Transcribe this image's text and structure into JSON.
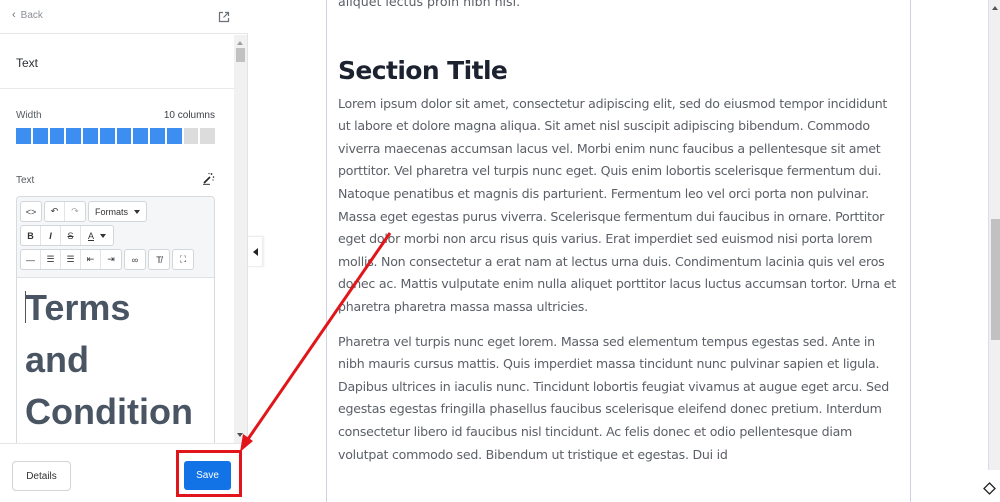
{
  "panel": {
    "back_label": "Back",
    "section_title": "Text",
    "width_label": "Width",
    "width_value": "10 columns",
    "columns_total": 12,
    "columns_selected": 10,
    "text_label": "Text",
    "toolbar": {
      "formats_label": "Formats",
      "buttons_row1": [
        "source-code",
        "undo",
        "redo"
      ],
      "buttons_row2": [
        "bold",
        "italic",
        "strikethrough",
        "text-color"
      ],
      "buttons_row3": [
        "horizontal-rule",
        "bullet-list",
        "numbered-list",
        "outdent",
        "indent",
        "link",
        "clear-formatting",
        "fullscreen"
      ],
      "bold_glyph": "B",
      "italic_glyph": "I",
      "strike_glyph": "S",
      "color_glyph": "A"
    },
    "editor_content": [
      "Terms",
      "and",
      "Condition"
    ],
    "details_label": "Details",
    "save_label": "Save"
  },
  "page": {
    "prev_text": "aliquet lectus proin nibh nisl.",
    "section_title": "Section Title",
    "paragraphs": [
      "Lorem ipsum dolor sit amet, consectetur adipiscing elit, sed do eiusmod tempor incididunt ut labore et dolore magna aliqua. Sit amet nisl suscipit adipiscing bibendum. Commodo viverra maecenas accumsan lacus vel. Morbi enim nunc faucibus a pellentesque sit amet porttitor. Vel pharetra vel turpis nunc eget. Quis enim lobortis scelerisque fermentum dui. Natoque penatibus et magnis dis parturient. Fermentum leo vel orci porta non pulvinar. Massa eget egestas purus viverra. Scelerisque fermentum dui faucibus in ornare. Porttitor eget dolor morbi non arcu risus quis varius. Erat imperdiet sed euismod nisi porta lorem mollis. Non consectetur a erat nam at lectus urna duis. Condimentum lacinia quis vel eros donec ac. Mattis vulputate enim nulla aliquet porttitor lacus luctus accumsan tortor. Urna et pharetra pharetra massa massa ultricies.",
      "Pharetra vel turpis nunc eget lorem. Massa sed elementum tempus egestas sed. Ante in nibh mauris cursus mattis. Quis imperdiet massa tincidunt nunc pulvinar sapien et ligula. Dapibus ultrices in iaculis nunc. Tincidunt lobortis feugiat vivamus at augue eget arcu. Sed egestas egestas fringilla phasellus faucibus scelerisque eleifend donec pretium. Interdum consectetur libero id faucibus nisl tincidunt. Ac felis donec et odio pellentesque diam volutpat commodo sed. Bibendum ut tristique et egestas. Dui id"
    ]
  },
  "annotation": {
    "color": "#e0161b",
    "target": "save-button"
  },
  "colors": {
    "accent": "#1273e6",
    "column_on": "#3c8ef0",
    "column_off": "#dcdcdc"
  }
}
